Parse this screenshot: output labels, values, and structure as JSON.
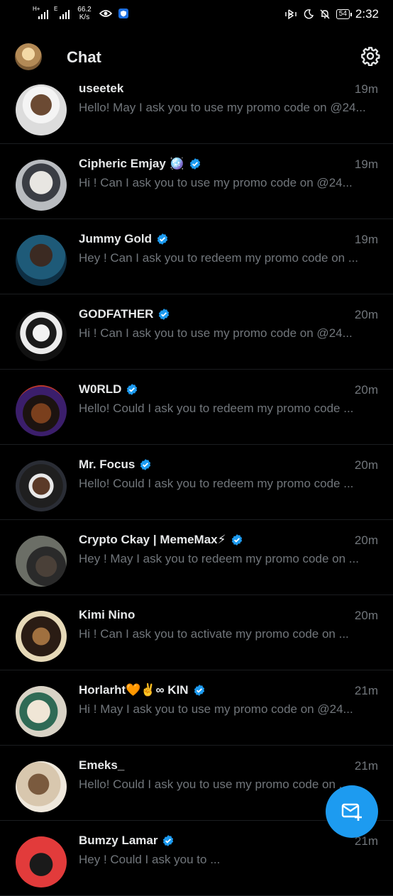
{
  "status": {
    "signal1_label": "H+",
    "signal2_label": "E",
    "net_speed": "66.2",
    "net_speed_unit": "K/s",
    "battery": "54",
    "time": "2:32"
  },
  "header": {
    "title": "Chat"
  },
  "colors": {
    "accent": "#1d9bf0",
    "verified": "#1d9bf0",
    "muted": "#71767b"
  },
  "chats": [
    {
      "name": "useetek",
      "time": "19m",
      "preview": "Hello!  May I ask you to  use  my promo code on  @24...",
      "verified": false
    },
    {
      "name": "Cipheric Emjay 🪩",
      "time": "19m",
      "preview": "Hi !  Can I ask you  to  use  my promo code on  @24...",
      "verified": true
    },
    {
      "name": "Jummy Gold",
      "time": "19m",
      "preview": "Hey !  Can I ask you  to  redeem my promo code on ...",
      "verified": true
    },
    {
      "name": "GODFATHER",
      "time": "20m",
      "preview": "Hi !  Can I ask you  to  use  my promo code on  @24...",
      "verified": true
    },
    {
      "name": "W0RLD",
      "time": "20m",
      "preview": "Hello! Could I ask you  to  redeem my promo code ...",
      "verified": true
    },
    {
      "name": "Mr. Focus",
      "time": "20m",
      "preview": "Hello! Could I ask you  to  redeem my promo code ...",
      "verified": true
    },
    {
      "name": "Crypto Ckay | MemeMax⚡",
      "time": "20m",
      "preview": "Hey !  May I ask you to  redeem my promo code on  ...",
      "verified": true
    },
    {
      "name": "Kimi Nino",
      "time": "20m",
      "preview": "Hi !  Can I ask you  to activate  my promo code on  ...",
      "verified": false
    },
    {
      "name": "Horlarht🧡✌️∞ KIN",
      "time": "21m",
      "preview": "Hi !  May I ask you to  use  my promo code on  @24...",
      "verified": true
    },
    {
      "name": "Emeks_",
      "time": "21m",
      "preview": "Hello! Could I ask you  to  use  my promo code on  ...",
      "verified": false
    },
    {
      "name": "Bumzy Lamar",
      "time": "21m",
      "preview": "Hey ! Could I ask you  to ...",
      "verified": true
    }
  ],
  "icons": {
    "settings": "gear-icon",
    "fab": "new-message-icon"
  }
}
